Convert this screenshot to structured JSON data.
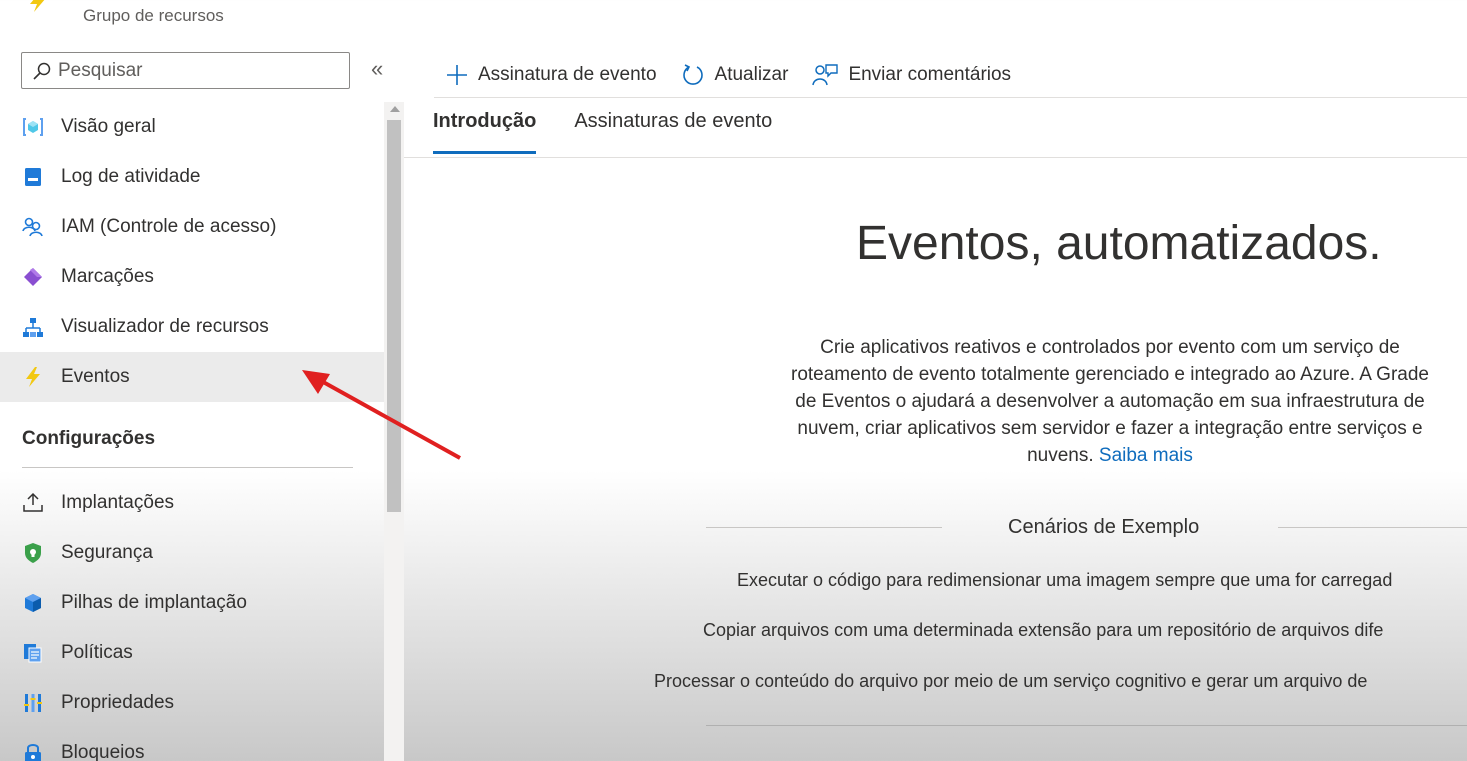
{
  "header": {
    "subtitle": "Grupo de recursos"
  },
  "sidebar": {
    "search_placeholder": "Pesquisar",
    "collapse_glyph": "«",
    "items": [
      {
        "label": "Visão geral",
        "icon": "overview-icon"
      },
      {
        "label": "Log de atividade",
        "icon": "activity-log-icon"
      },
      {
        "label": "IAM (Controle de acesso)",
        "icon": "iam-icon"
      },
      {
        "label": "Marcações",
        "icon": "tag-icon"
      },
      {
        "label": "Visualizador de recursos",
        "icon": "resource-visualizer-icon"
      },
      {
        "label": "Eventos",
        "icon": "lightning-icon",
        "active": true
      }
    ],
    "section_title": "Configurações",
    "settings_items": [
      {
        "label": "Implantações",
        "icon": "upload-icon"
      },
      {
        "label": "Segurança",
        "icon": "shield-icon"
      },
      {
        "label": "Pilhas de implantação",
        "icon": "cube-icon"
      },
      {
        "label": "Políticas",
        "icon": "policy-icon"
      },
      {
        "label": "Propriedades",
        "icon": "properties-icon"
      },
      {
        "label": "Bloqueios",
        "icon": "lock-icon"
      }
    ]
  },
  "toolbar": {
    "add_subscription": "Assinatura de evento",
    "refresh": "Atualizar",
    "feedback": "Enviar comentários"
  },
  "tabs": [
    {
      "label": "Introdução",
      "active": true
    },
    {
      "label": "Assinaturas de evento",
      "active": false
    }
  ],
  "hero": {
    "title": "Eventos, automatizados.",
    "description": "Crie aplicativos reativos e controlados por evento com um serviço de roteamento de evento totalmente gerenciado e integrado ao Azure. A Grade de Eventos o ajudará a desenvolver a automação em sua infraestrutura de nuvem, criar aplicativos sem servidor e fazer a integração entre serviços e nuvens.",
    "learn_more": "Saiba mais"
  },
  "scenarios": {
    "title": "Cenários de Exemplo",
    "items": [
      "Executar o código para redimensionar uma imagem sempre que uma for carregad",
      "Copiar arquivos com uma determinada extensão para um repositório de arquivos dife",
      "Processar o conteúdo do arquivo por meio de um serviço cognitivo e gerar um arquivo de"
    ]
  },
  "colors": {
    "accent": "#0f6cbd",
    "annotation_arrow": "#e02020",
    "active_item_bg": "#ebebeb"
  }
}
